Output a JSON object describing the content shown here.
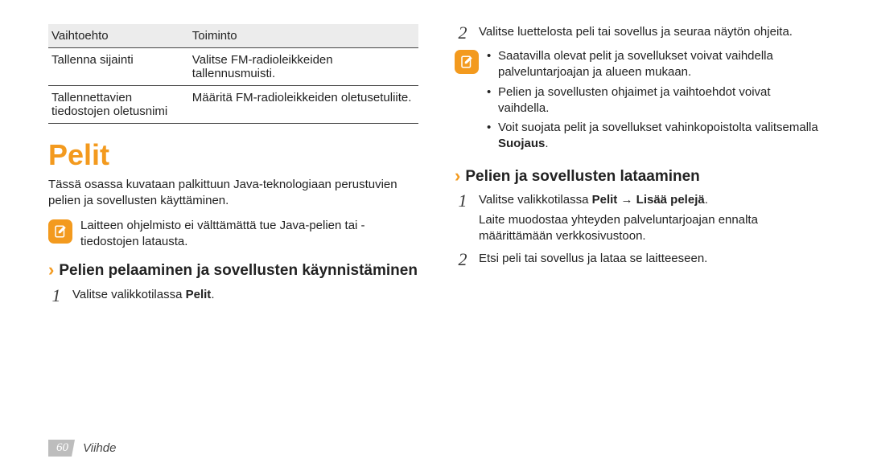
{
  "options_table": {
    "headers": {
      "col1": "Vaihtoehto",
      "col2": "Toiminto"
    },
    "rows": [
      {
        "opt": "Tallenna sijainti",
        "desc": "Valitse FM-radioleikkeiden tallennusmuisti."
      },
      {
        "opt": "Tallennettavien tiedostojen oletusnimi",
        "desc": "Määritä FM-radioleikkeiden oletusetuliite."
      }
    ]
  },
  "section": {
    "title": "Pelit",
    "intro": "Tässä osassa kuvataan palkittuun Java-teknologiaan perustuvien pelien ja sovellusten käyttäminen.",
    "note1": "Laitteen ohjelmisto ei välttämättä tue Java-pelien tai -tiedostojen latausta."
  },
  "sub1": {
    "title": "Pelien pelaaminen ja sovellusten käynnistäminen",
    "step1_prefix": "Valitse valikkotilassa ",
    "step1_bold": "Pelit",
    "step1_suffix": ".",
    "step2": "Valitse luettelosta peli tai sovellus ja seuraa näytön ohjeita.",
    "note_items": [
      "Saatavilla olevat pelit ja sovellukset voivat vaihdella palveluntarjoajan ja alueen mukaan.",
      "Pelien ja sovellusten ohjaimet ja vaihtoehdot voivat vaihdella.",
      {
        "pre": "Voit suojata pelit ja sovellukset vahinkopoistolta valitsemalla ",
        "bold": "Suojaus",
        "post": "."
      }
    ]
  },
  "sub2": {
    "title": "Pelien ja sovellusten lataaminen",
    "step1_prefix": "Valitse valikkotilassa ",
    "step1_bold1": "Pelit",
    "step1_arrow": " → ",
    "step1_bold2": "Lisää pelejä",
    "step1_suffix": ".",
    "step1_extra": "Laite muodostaa yhteyden palveluntarjoajan ennalta määrittämään verkkosivustoon.",
    "step2": "Etsi peli tai sovellus ja lataa se laitteeseen."
  },
  "footer": {
    "page": "60",
    "section": "Viihde"
  }
}
